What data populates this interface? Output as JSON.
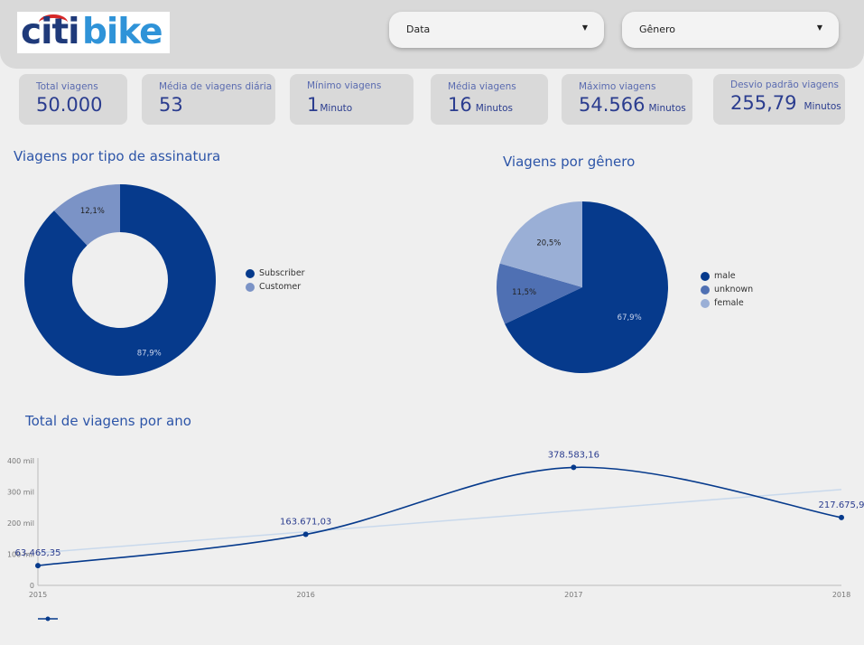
{
  "brand": {
    "logo_part1": "citi",
    "logo_part2": "bike"
  },
  "filters": [
    {
      "label": "Data"
    },
    {
      "label": "Gênero"
    }
  ],
  "kpis": [
    {
      "title": "Total viagens",
      "value": "50.000",
      "unit": ""
    },
    {
      "title": "Média de viagens diária",
      "value": "53",
      "unit": ""
    },
    {
      "title": "Mínimo viagens",
      "value": "1",
      "unit": "Minuto"
    },
    {
      "title": "Média viagens",
      "value": "16",
      "unit": "Minutos"
    },
    {
      "title": "Máximo viagens",
      "value": "54.566",
      "unit": "Minutos"
    },
    {
      "title": "Desvio padrão viagens",
      "value": "255,79",
      "unit": "Minutos"
    }
  ],
  "colors": {
    "dark_blue": "#063a8c",
    "mid_blue": "#5c7fbf",
    "light_blue": "#9aafd6",
    "trend": "#c9d9ec"
  },
  "chart_data": [
    {
      "type": "pie",
      "title": "Viagens por tipo de assinatura",
      "donut": true,
      "categories": [
        "Subscriber",
        "Customer"
      ],
      "values": [
        87.9,
        12.1
      ],
      "labels": [
        "87,9%",
        "12,1%"
      ],
      "colors": [
        "#063a8c",
        "#7b93c6"
      ],
      "legend": "right"
    },
    {
      "type": "pie",
      "title": "Viagens por gênero",
      "donut": false,
      "categories": [
        "male",
        "unknown",
        "female"
      ],
      "values": [
        67.9,
        11.5,
        20.5
      ],
      "labels": [
        "67,9%",
        "11,5%",
        "20,5%"
      ],
      "colors": [
        "#063a8c",
        "#4f70b3",
        "#9aafd6"
      ],
      "legend": "right"
    },
    {
      "type": "line",
      "title": "Total de viagens por ano",
      "x": [
        "2015",
        "2016",
        "2017",
        "2018"
      ],
      "series": [
        {
          "values": [
            63465.35,
            163671.03,
            378583.16,
            217675.9
          ],
          "labels": [
            "63.465,35",
            "163.671,03",
            "378.583,16",
            "217.675,9"
          ]
        }
      ],
      "trendline": true,
      "ylim": [
        0,
        400000
      ],
      "yticks": [
        0,
        100000,
        200000,
        300000,
        400000
      ],
      "ytick_labels": [
        "0",
        "100 mil",
        "200 mil",
        "300 mil",
        "400 mil"
      ],
      "grid": false,
      "legend": "bottom-left"
    }
  ]
}
